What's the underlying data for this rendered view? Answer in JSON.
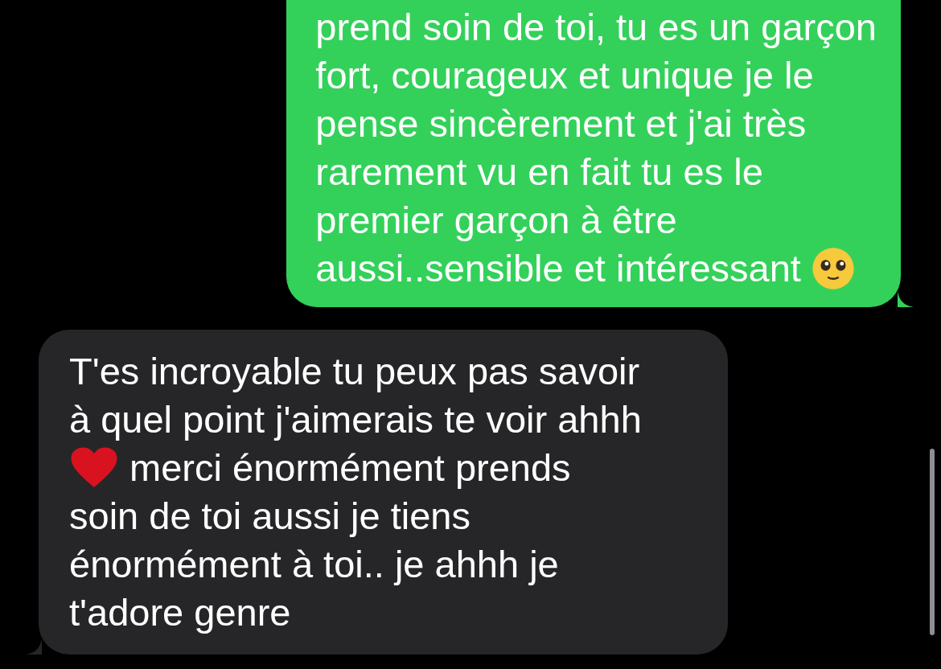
{
  "messages": [
    {
      "kind": "sent",
      "parts": [
        {
          "kind": "text",
          "text": "prend soin de toi, tu es un garçon\nfort, courageux et unique je le\npense sincèrement et j'ai très\nrarement vu en fait tu es le\npremier garçon à être\naussi..sensible et intéressant "
        },
        {
          "kind": "face"
        }
      ]
    },
    {
      "kind": "received",
      "parts": [
        {
          "kind": "text",
          "text": "T'es incroyable tu peux pas savoir\nà quel point j'aimerais te voir ahhh\n"
        },
        {
          "kind": "heart"
        },
        {
          "kind": "text",
          "text": " merci énormément prends\nsoin de toi aussi je tiens\nénormément à toi.. je ahhh je\nt'adore genre"
        }
      ]
    }
  ]
}
